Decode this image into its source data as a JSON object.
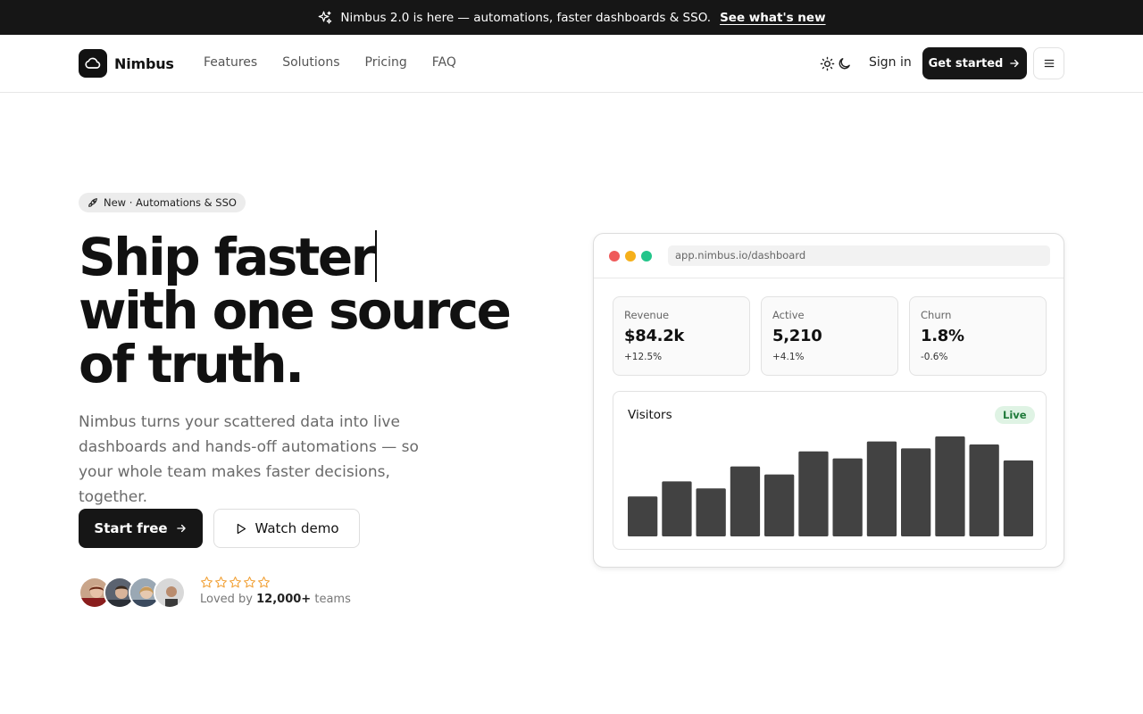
{
  "announcement": {
    "text": "Nimbus 2.0 is here — automations, faster dashboards & SSO.",
    "link": "See what's new",
    "icon": "sparkle-icon"
  },
  "nav": {
    "brand": "Nimbus",
    "links": [
      "Features",
      "Solutions",
      "Pricing",
      "FAQ"
    ],
    "sign_in": "Sign in",
    "cta": "Get started",
    "theme_icons": [
      "sun-icon",
      "moon-icon"
    ],
    "menu_icon": "hamburger-icon"
  },
  "hero": {
    "pill": "New · Automations & SSO",
    "headline_line1": "Ship faster",
    "headline_rest": "with one source of truth.",
    "subtext": "Nimbus turns your scattered data into live dashboards and hands-off automations — so your whole team makes faster decisions, together.",
    "primary_button": "Start free",
    "secondary_button": "Watch demo",
    "social": {
      "rating_stars": 5,
      "loved_prefix": "Loved by",
      "loved_count": "12,000+",
      "loved_suffix": "teams"
    }
  },
  "dashboard": {
    "url": "app.nimbus.io/dashboard",
    "stats": [
      {
        "label": "Revenue",
        "value": "$84.2k",
        "delta": "+12.5%"
      },
      {
        "label": "Active",
        "value": "5,210",
        "delta": "+4.1%"
      },
      {
        "label": "Churn",
        "value": "1.8%",
        "delta": "-0.6%"
      }
    ],
    "chart_title": "Visitors",
    "live_badge": "Live",
    "bar_values": [
      40,
      55,
      48,
      70,
      62,
      85,
      78,
      95,
      88,
      100,
      92,
      76
    ]
  },
  "colors": {
    "dark": "#161616",
    "dot_red": "#ef5b5b",
    "dot_yellow": "#f5b01b",
    "dot_green": "#23c58a",
    "bar": "#424242",
    "star": "#f2a33a",
    "live_bg": "#dff3e4",
    "live_fg": "#1f7a3a"
  }
}
